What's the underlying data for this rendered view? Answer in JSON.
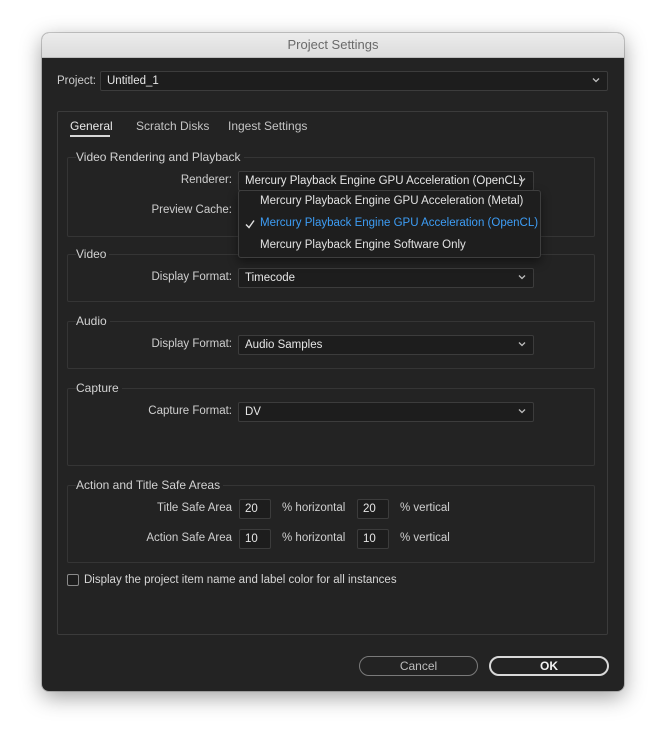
{
  "window": {
    "title": "Project Settings"
  },
  "project": {
    "label": "Project:",
    "value": "Untitled_1"
  },
  "tabs": [
    {
      "label": "General",
      "active": true
    },
    {
      "label": "Scratch Disks",
      "active": false
    },
    {
      "label": "Ingest Settings",
      "active": false
    }
  ],
  "video_rendering": {
    "title": "Video Rendering and Playback",
    "renderer_label": "Renderer:",
    "renderer_value": "Mercury Playback Engine GPU Acceleration (OpenCL)",
    "preview_cache_label": "Preview Cache:"
  },
  "renderer_menu": {
    "options": [
      {
        "label": "Mercury Playback Engine GPU Acceleration (Metal)",
        "selected": false
      },
      {
        "label": "Mercury Playback Engine GPU Acceleration (OpenCL)",
        "selected": true
      },
      {
        "label": "Mercury Playback Engine Software Only",
        "selected": false
      }
    ],
    "selected_color": "#3d9df5"
  },
  "video": {
    "title": "Video",
    "display_format_label": "Display Format:",
    "display_format_value": "Timecode"
  },
  "audio": {
    "title": "Audio",
    "display_format_label": "Display Format:",
    "display_format_value": "Audio Samples"
  },
  "capture": {
    "title": "Capture",
    "capture_format_label": "Capture Format:",
    "capture_format_value": "DV"
  },
  "safe_areas": {
    "title": "Action and Title Safe Areas",
    "title_safe_label": "Title Safe Area",
    "title_safe_horizontal": "20",
    "title_safe_vertical": "20",
    "action_safe_label": "Action Safe Area",
    "action_safe_horizontal": "10",
    "action_safe_vertical": "10",
    "horizontal_unit": "% horizontal",
    "vertical_unit": "% vertical"
  },
  "display_label_option": {
    "label": "Display the project item name and label color for all instances",
    "checked": false
  },
  "buttons": {
    "cancel": "Cancel",
    "ok": "OK"
  },
  "icons": {
    "dropdown": "chevron-down-icon",
    "selected_mark": "checkmark-icon"
  }
}
